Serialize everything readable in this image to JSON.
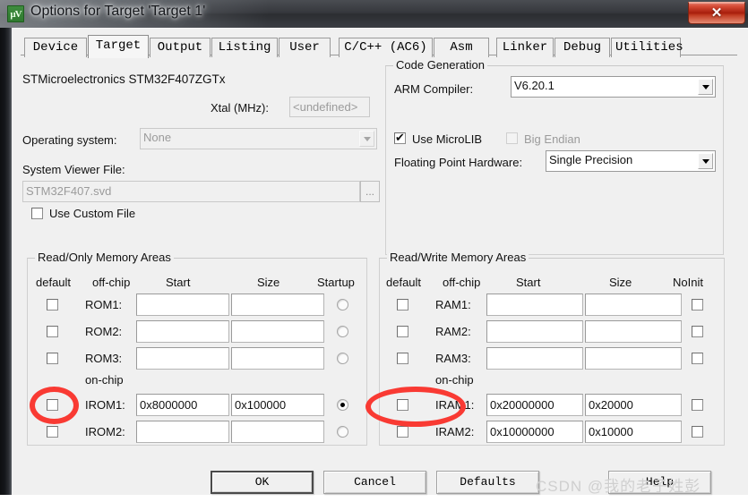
{
  "window": {
    "title": "Options for Target 'Target 1'",
    "icon": "keil-uvision-icon",
    "close_label": "✕"
  },
  "tabs": [
    {
      "label": "Device",
      "active": false
    },
    {
      "label": "Target",
      "active": true
    },
    {
      "label": "Output",
      "active": false
    },
    {
      "label": "Listing",
      "active": false
    },
    {
      "label": "User",
      "active": false
    },
    {
      "label": "C/C++ (AC6)",
      "active": false
    },
    {
      "label": "Asm",
      "active": false
    },
    {
      "label": "Linker",
      "active": false
    },
    {
      "label": "Debug",
      "active": false
    },
    {
      "label": "Utilities",
      "active": false
    }
  ],
  "device": {
    "name": "STMicroelectronics STM32F407ZGTx",
    "xtal_label": "Xtal (MHz):",
    "xtal_value": "<undefined>",
    "os_label": "Operating system:",
    "os_value": "None",
    "svd_label": "System Viewer File:",
    "svd_value": "STM32F407.svd",
    "svd_browse_label": "...",
    "use_custom_file_label": "Use Custom File",
    "use_custom_file_checked": false
  },
  "code_generation": {
    "title": "Code Generation",
    "arm_compiler_label": "ARM Compiler:",
    "arm_compiler_value": "V6.20.1",
    "use_microlib_label": "Use MicroLIB",
    "use_microlib_checked": true,
    "big_endian_label": "Big Endian",
    "big_endian_checked": false,
    "big_endian_disabled": true,
    "fpu_label": "Floating Point Hardware:",
    "fpu_value": "Single Precision"
  },
  "read_only_memory": {
    "title": "Read/Only Memory Areas",
    "headers": {
      "default": "default",
      "offchip": "off-chip",
      "start": "Start",
      "size": "Size",
      "last": "Startup"
    },
    "onchip_label": "on-chip",
    "rows": [
      {
        "name": "ROM1:",
        "start": "",
        "size": "",
        "default": false,
        "flag": false
      },
      {
        "name": "ROM2:",
        "start": "",
        "size": "",
        "default": false,
        "flag": false
      },
      {
        "name": "ROM3:",
        "start": "",
        "size": "",
        "default": false,
        "flag": false
      },
      {
        "name": "IROM1:",
        "start": "0x8000000",
        "size": "0x100000",
        "default": false,
        "flag": true
      },
      {
        "name": "IROM2:",
        "start": "",
        "size": "",
        "default": false,
        "flag": false
      }
    ]
  },
  "read_write_memory": {
    "title": "Read/Write Memory Areas",
    "headers": {
      "default": "default",
      "offchip": "off-chip",
      "start": "Start",
      "size": "Size",
      "last": "NoInit"
    },
    "onchip_label": "on-chip",
    "rows": [
      {
        "name": "RAM1:",
        "start": "",
        "size": "",
        "default": false,
        "flag": false
      },
      {
        "name": "RAM2:",
        "start": "",
        "size": "",
        "default": false,
        "flag": false
      },
      {
        "name": "RAM3:",
        "start": "",
        "size": "",
        "default": false,
        "flag": false
      },
      {
        "name": "IRAM1:",
        "start": "0x20000000",
        "size": "0x20000",
        "default": false,
        "flag": false
      },
      {
        "name": "IRAM2:",
        "start": "0x10000000",
        "size": "0x10000",
        "default": false,
        "flag": false
      }
    ]
  },
  "footer": {
    "ok": "OK",
    "cancel": "Cancel",
    "defaults": "Defaults",
    "help": "Help"
  },
  "annotations": {
    "watermark": "CSDN @我的老子姓彭",
    "highlight_color": "#f93a33",
    "highlight_targets": [
      "irom1-default-checkbox",
      "iram1-default-checkbox"
    ]
  }
}
